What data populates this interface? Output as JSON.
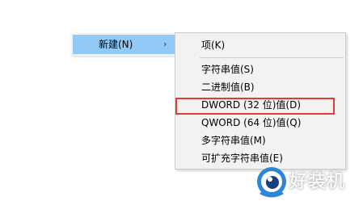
{
  "parent_menu": {
    "new_item": {
      "label": "新建(N)",
      "arrow": "›"
    }
  },
  "submenu": {
    "items": [
      {
        "label": "项(K)"
      },
      {
        "label": "字符串值(S)"
      },
      {
        "label": "二进制值(B)"
      },
      {
        "label": "DWORD (32 位)值(D)"
      },
      {
        "label": "QWORD (64 位)值(Q)"
      },
      {
        "label": "多字符串值(M)"
      },
      {
        "label": "可扩充字符串值(E)"
      }
    ],
    "highlight_color": "#e03c31"
  },
  "watermark": {
    "text": "好装机",
    "icon": "eye-logo-icon",
    "colors": {
      "ring": "#2b86d6",
      "pupil": "#1a3f7a"
    }
  },
  "colors": {
    "menu_background": "#f2f2f2",
    "hover_background": "#91c9f7"
  }
}
